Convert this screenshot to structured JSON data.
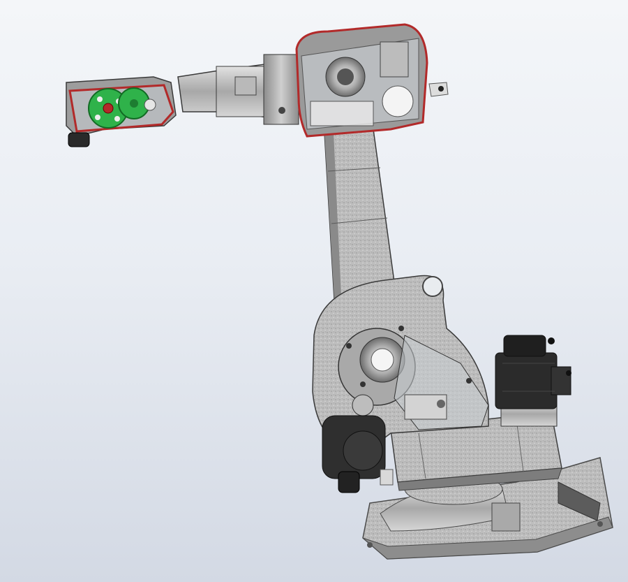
{
  "viewport": {
    "background_top": "#f4f6f9",
    "background_bottom": "#d3d9e4"
  },
  "model": {
    "subject": "industrial-robot-arm",
    "casting_color": "#bdbdbd",
    "housing_color": "#9a9a9a",
    "transparent_cover_edge_color": "#b22a2a",
    "gear_color": "#2fb24a",
    "motor_color": "#2b2b2b",
    "link_color": "#c9c9c9"
  }
}
